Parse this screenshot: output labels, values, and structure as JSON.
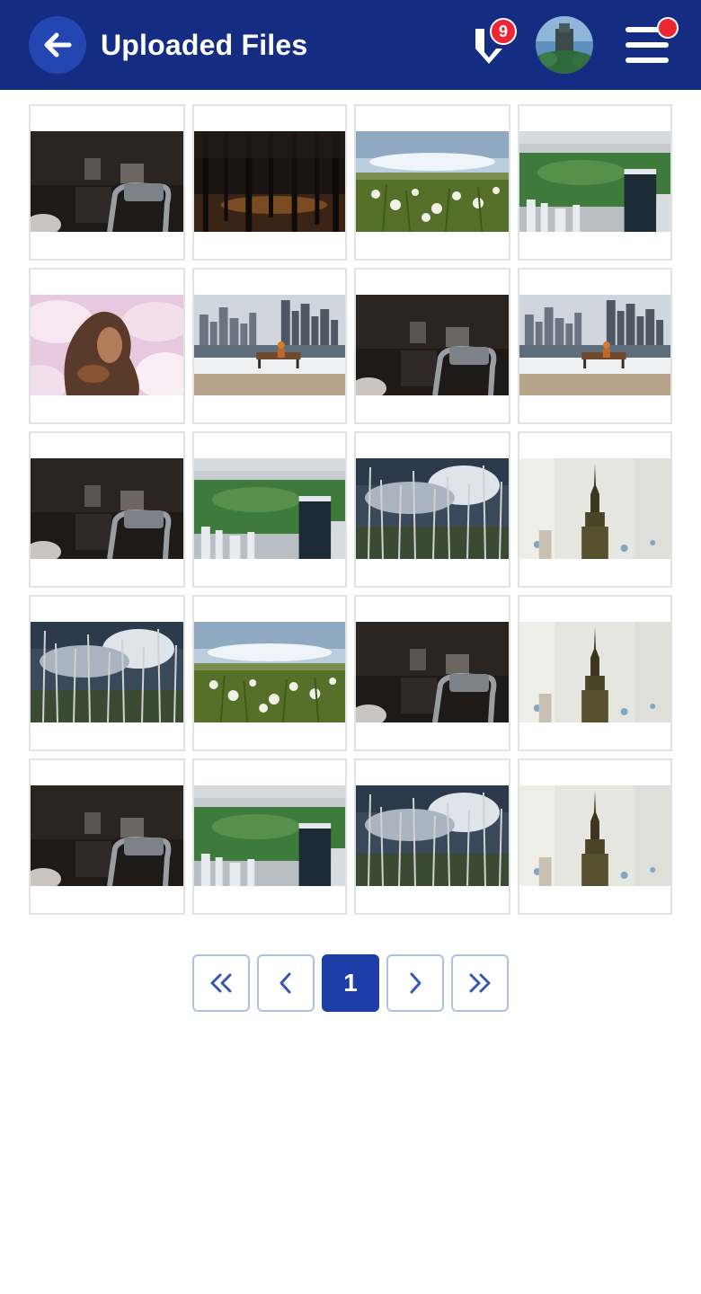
{
  "header": {
    "title": "Uploaded Files",
    "notification_count": "9",
    "colors": {
      "background": "#142d82",
      "accent": "#2346b3",
      "badge": "#ed2633"
    }
  },
  "icons": {
    "back": "arrow-left-icon",
    "brand": "brand-logo-icon",
    "menu": "hamburger-menu-icon",
    "first": "double-chevron-left-icon",
    "prev": "chevron-left-icon",
    "next": "chevron-right-icon",
    "last": "double-chevron-right-icon"
  },
  "files": [
    {
      "scene": "projector"
    },
    {
      "scene": "forest-dark"
    },
    {
      "scene": "dandelions"
    },
    {
      "scene": "city-park"
    },
    {
      "scene": "woman-clouds"
    },
    {
      "scene": "skyline-bench"
    },
    {
      "scene": "projector"
    },
    {
      "scene": "skyline-bench"
    },
    {
      "scene": "projector"
    },
    {
      "scene": "city-park"
    },
    {
      "scene": "dead-trees"
    },
    {
      "scene": "empire-state"
    },
    {
      "scene": "dead-trees"
    },
    {
      "scene": "dandelions"
    },
    {
      "scene": "projector"
    },
    {
      "scene": "empire-state"
    },
    {
      "scene": "projector"
    },
    {
      "scene": "city-park"
    },
    {
      "scene": "dead-trees"
    },
    {
      "scene": "empire-state"
    }
  ],
  "pagination": {
    "current_page": "1",
    "active_color": "#1d3ea6"
  }
}
